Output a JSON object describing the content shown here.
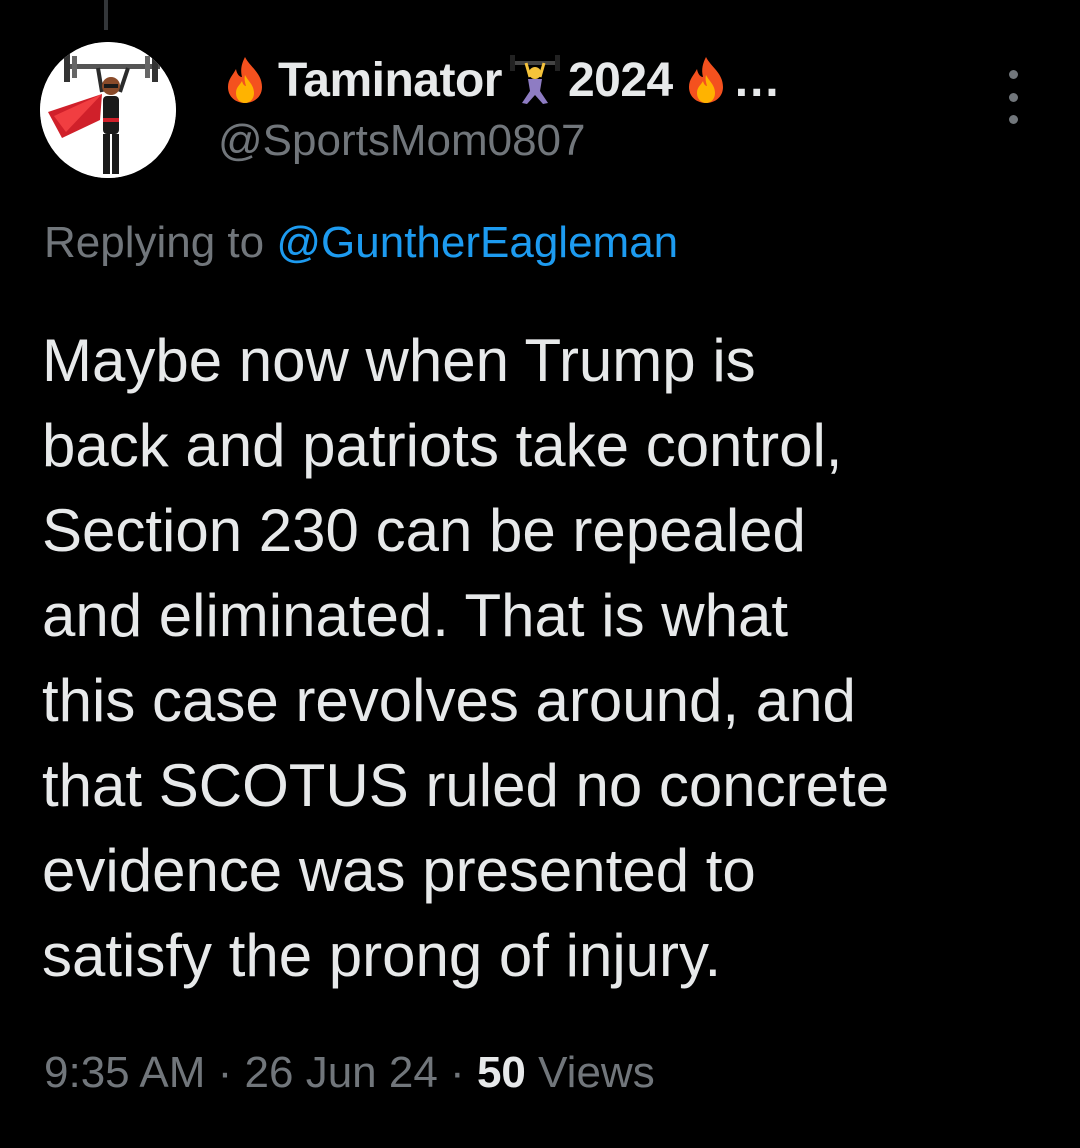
{
  "tweet": {
    "display_name_pre_icon": "fire-emoji",
    "display_name_part1": "Taminator",
    "display_name_mid_icon": "weightlifter-emoji",
    "display_name_part2": "2024",
    "display_name_post_icon": "fire-emoji",
    "display_name_ellipsis": "…",
    "handle": "@SportsMom0807",
    "replying_prefix": "Replying to ",
    "replying_to": "@GuntherEagleman",
    "body": "Maybe now when Trump is\nback and patriots take control,\nSection 230 can be repealed\nand eliminated.  That is what\nthis case revolves around, and\nthat SCOTUS ruled no concrete\nevidence was presented to\nsatisfy the prong of injury.",
    "time": "9:35 AM",
    "separator": " · ",
    "date": "26 Jun 24",
    "views_count": "50",
    "views_label": " Views"
  },
  "icons": {
    "more": "more-vertical-icon",
    "avatar": "superhero-weightlifter-avatar"
  },
  "colors": {
    "background": "#000000",
    "primary_text": "#e7e9ea",
    "secondary_text": "#71767b",
    "link": "#1d9bf0"
  }
}
